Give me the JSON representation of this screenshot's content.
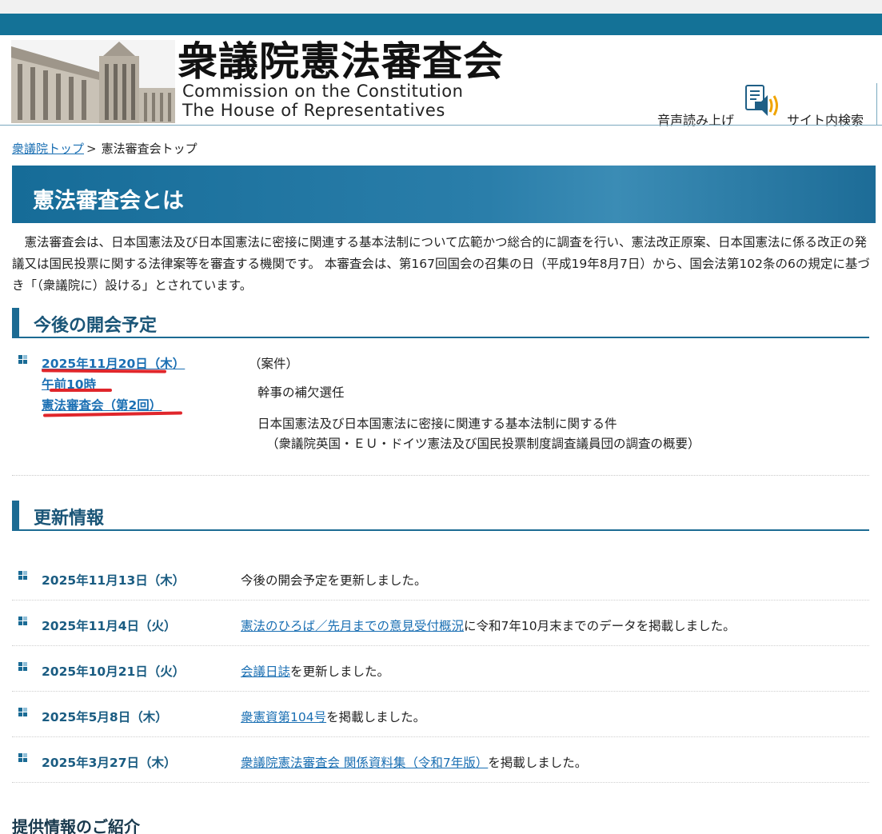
{
  "header": {
    "title_jp": "衆議院憲法審査会",
    "title_en_line1": "Commission on the Constitution",
    "title_en_line2": "The House of  Representatives",
    "speech_label": "音声読み上げ",
    "search_label": "サイト内検索"
  },
  "breadcrumb": {
    "home": "衆議院トップ",
    "separator": ">",
    "current": "憲法審査会トップ"
  },
  "hero": {
    "title": "憲法審査会とは"
  },
  "intro": "憲法審査会は、日本国憲法及び日本国憲法に密接に関連する基本法制について広範かつ総合的に調査を行い、憲法改正原案、日本国憲法に係る改正の発議又は国民投票に関する法律案等を審査する機関です。 本審査会は、第167回国会の召集の日（平成19年8月7日）から、国会法第102条の6の規定に基づき「（衆議院に）設ける」とされています。",
  "schedule": {
    "heading": "今後の開会予定",
    "date": "2025年11月20日（木）",
    "time": "午前10時",
    "session": "憲法審査会（第2回）",
    "case_label": "（案件）",
    "items": [
      "幹事の補欠選任",
      "日本国憲法及び日本国憲法に密接に関連する基本法制に関する件",
      "（衆議院英国・ＥＵ・ドイツ憲法及び国民投票制度調査議員団の調査の概要）"
    ]
  },
  "news": {
    "heading": "更新情報",
    "rows": [
      {
        "date": "2025年11月13日（木）",
        "link": "",
        "text": "今後の開会予定を更新しました。"
      },
      {
        "date": "2025年11月4日（火）",
        "link": "憲法のひろば／先月までの意見受付概況",
        "text": "に令和7年10月末までのデータを掲載しました。"
      },
      {
        "date": "2025年10月21日（火）",
        "link": "会議日誌",
        "text": "を更新しました。"
      },
      {
        "date": "2025年5月8日（木）",
        "link": "衆憲資第104号",
        "text": "を掲載しました。"
      },
      {
        "date": "2025年3月27日（木）",
        "link": "衆議院憲法審査会 関係資料集（令和7年版）",
        "text": "を掲載しました。"
      }
    ]
  },
  "provide_heading": "提供情報のご紹介",
  "colors": {
    "brand": "#147297",
    "link": "#1a6fb3",
    "annotation": "#e0262b"
  }
}
